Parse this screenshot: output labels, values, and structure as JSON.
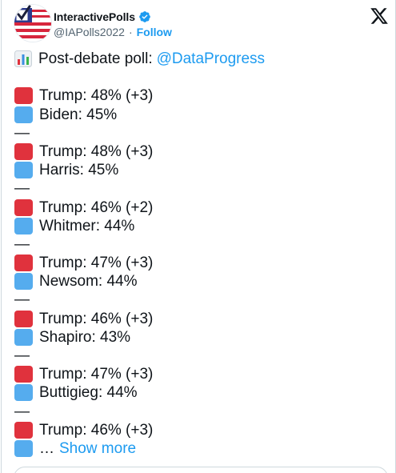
{
  "account": {
    "display_name": "InteractivePolls",
    "handle": "@IAPolls2022",
    "separator": "·",
    "follow_label": "Follow",
    "verified": true,
    "avatar_icon": "check-flag-avatar",
    "platform_icon": "x-logo-icon"
  },
  "colors": {
    "link": "#1d9bf0",
    "red_square": "#e0323d",
    "blue_square": "#55acee",
    "text": "#0f1419",
    "muted": "#536471"
  },
  "tweet": {
    "intro_icon": "bar-chart-icon",
    "intro_text": "Post-debate poll:",
    "mention": "@DataProgress",
    "separator_glyph": "—",
    "matchups": [
      {
        "trump": "Trump: 48% (+3)",
        "opponent": "Biden: 45%"
      },
      {
        "trump": "Trump: 48% (+3)",
        "opponent": "Harris: 45%"
      },
      {
        "trump": "Trump: 46% (+2)",
        "opponent": "Whitmer: 44%"
      },
      {
        "trump": "Trump: 47% (+3)",
        "opponent": "Newsom: 44%"
      },
      {
        "trump": "Trump: 46% (+3)",
        "opponent": "Shapiro: 43%"
      },
      {
        "trump": "Trump: 47% (+3)",
        "opponent": "Buttigieg: 44%"
      }
    ],
    "last_trump": "Trump: 46% (+3)",
    "ellipsis": "…",
    "show_more_label": "Show more"
  }
}
